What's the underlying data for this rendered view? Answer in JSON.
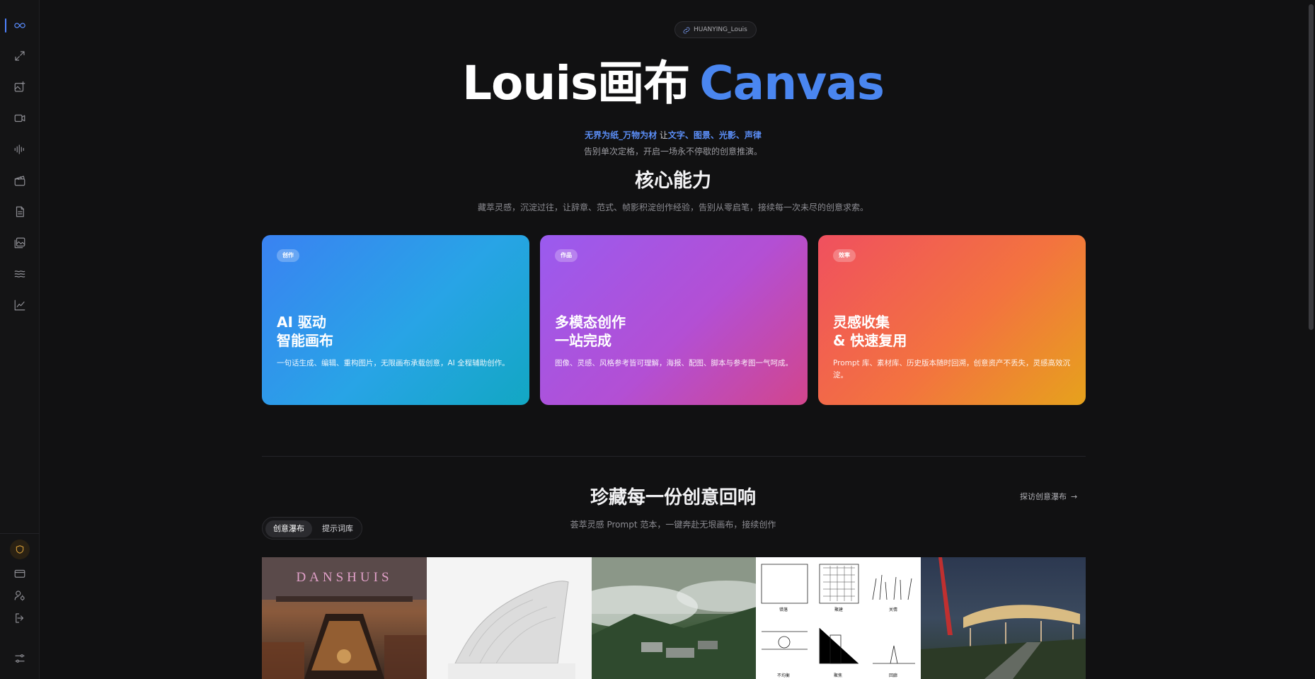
{
  "sidebar": {
    "items": [
      {
        "name": "infinity-icon",
        "active": true
      },
      {
        "name": "expand-icon"
      },
      {
        "name": "image-add-icon"
      },
      {
        "name": "video-icon"
      },
      {
        "name": "audio-wave-icon"
      },
      {
        "name": "clapperboard-icon"
      },
      {
        "name": "document-icon"
      },
      {
        "name": "gallery-icon"
      },
      {
        "name": "waves-icon"
      },
      {
        "name": "chart-line-icon"
      }
    ],
    "bottom": [
      {
        "name": "shield-icon"
      },
      {
        "name": "card-icon"
      },
      {
        "name": "user-settings-icon"
      },
      {
        "name": "logout-icon"
      },
      {
        "name": "sliders-icon"
      }
    ]
  },
  "header": {
    "pill_label": "HUANYING_Louis",
    "title_main": "Louis画布",
    "title_accent": "Canvas",
    "tagline_hl1": "无界为纸_万物为材",
    "tagline_mid": " 让",
    "tagline_hl2": "文字、图景、光影、声律",
    "tagline2": "告别单次定格，开启一场永不停歇的创意推演。"
  },
  "core": {
    "title": "核心能力",
    "subtitle": "藏萃灵感，沉淀过往，让辞章、范式、帧影积淀创作经验，告别从零启笔，接续每一次未尽的创意求索。",
    "cards": [
      {
        "badge": "创作",
        "title_line1": "AI 驱动",
        "title_line2": "智能画布",
        "desc": "一句话生成、编辑、重构图片，无限画布承载创意，AI 全程辅助创作。"
      },
      {
        "badge": "作品",
        "title_line1": "多模态创作",
        "title_line2": "一站完成",
        "desc": "图像、灵感、风格参考皆可理解，海报、配图、脚本与参考图一气呵成。"
      },
      {
        "badge": "效率",
        "title_line1": "灵感收集",
        "title_line2": "& 快速复用",
        "desc": "Prompt 库、素材库、历史版本随时回溯，创意资产不丢失，灵感高效沉淀。"
      }
    ]
  },
  "gallery": {
    "title": "珍藏每一份创意回响",
    "subtitle": "荟萃灵感 Prompt 范本，一键奔赴无垠画布，接续创作",
    "explore_label": "探访创意瀑布",
    "tabs": [
      "创意瀑布",
      "提示词库"
    ],
    "active_tab": "创意瀑布",
    "thumb1_sign": "DANSHUIS",
    "thumb4_labels": [
      "错落",
      "聚建",
      "关情",
      "不均衡",
      "聚焦",
      "回廊"
    ]
  },
  "colors": {
    "accent": "#4a86f0",
    "background": "#111112"
  }
}
